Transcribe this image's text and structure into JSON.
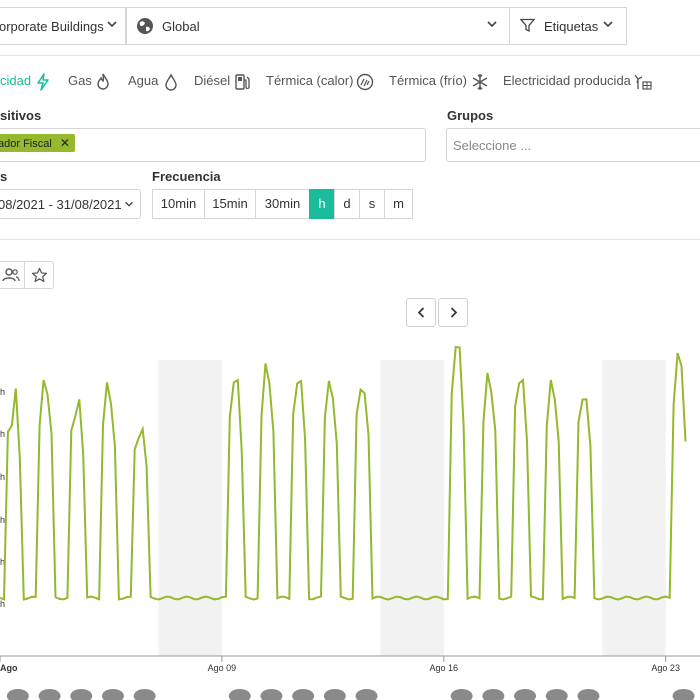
{
  "topbar": {
    "group_select": "orporate Buildings",
    "scope_select": "Global",
    "tags_select": "Etiquetas"
  },
  "energy_tabs": [
    {
      "label": "cidad",
      "icon": "lightning-icon",
      "active": true
    },
    {
      "label": "Gas",
      "icon": "flame-icon"
    },
    {
      "label": "Agua",
      "icon": "water-drop-icon"
    },
    {
      "label": "Diésel",
      "icon": "fuel-pump-icon"
    },
    {
      "label": "Térmica (calor)",
      "icon": "heat-icon"
    },
    {
      "label": "Térmica (frío)",
      "icon": "snowflake-icon"
    },
    {
      "label": "Electricidad producida",
      "icon": "wind-solar-icon"
    }
  ],
  "filters": {
    "devices_label": "sitivos",
    "device_chip": "ador Fiscal",
    "groups_label": "Grupos",
    "groups_placeholder": "Seleccione ...",
    "dates_label": "s",
    "date_range": "08/2021 - 31/08/2021",
    "frequency_label": "Frecuencia",
    "frequency_options": [
      "10min",
      "15min",
      "30min",
      "h",
      "d",
      "s",
      "m"
    ],
    "frequency_selected": "h"
  },
  "colors": {
    "accent": "#1abc9c",
    "series": "#95b82e",
    "weekend_band": "#f2f2f2"
  },
  "chart_data": {
    "type": "line",
    "y_tick_labels": [
      "h",
      "h",
      "h",
      "h",
      "h",
      "h"
    ],
    "x_tick_labels": [
      "Ago",
      "Ago 09",
      "Ago 16",
      "Ago 23"
    ],
    "grid": false,
    "series": [
      {
        "values": [
          0.15,
          0.15,
          1.1,
          1.2,
          1.35,
          1.0,
          0.15,
          0.15,
          0.15,
          0.15,
          1.2,
          1.4,
          1.38,
          1.1,
          0.15,
          0.15,
          0.15,
          0.15,
          1.1,
          1.25,
          1.3,
          1.0,
          0.15,
          0.15,
          0.15,
          0.15,
          1.2,
          1.4,
          1.3,
          1.05,
          0.15,
          0.15,
          0.15,
          0.15,
          1.0,
          1.1,
          1.15,
          0.9,
          0.15,
          0.15,
          0.15,
          0.15,
          0.15,
          0.15,
          0.15,
          0.15,
          0.15,
          0.15,
          0.15,
          0.15,
          0.15,
          0.15,
          0.15,
          0.15,
          0.15,
          0.15,
          0.15,
          0.15,
          1.2,
          1.45,
          1.4,
          1.05,
          0.15,
          0.15,
          0.15,
          0.15,
          1.25,
          1.5,
          1.45,
          1.1,
          0.15,
          0.15,
          0.15,
          0.15,
          1.2,
          1.45,
          1.4,
          1.1,
          0.15,
          0.15,
          0.15,
          0.15,
          1.25,
          1.4,
          1.35,
          1.05,
          0.15,
          0.15,
          0.15,
          0.15,
          1.2,
          1.4,
          1.35,
          1.1,
          0.15,
          0.15,
          0.15,
          0.15,
          0.15,
          0.15,
          0.15,
          0.15,
          0.15,
          0.15,
          0.15,
          0.15,
          0.15,
          0.15,
          0.15,
          0.15,
          0.15,
          0.15,
          0.15,
          0.15,
          1.35,
          1.65,
          1.6,
          1.2,
          0.15,
          0.15,
          0.15,
          0.15,
          1.2,
          1.45,
          1.4,
          1.1,
          0.15,
          0.15,
          0.15,
          0.15,
          1.25,
          1.45,
          1.4,
          1.1,
          0.15,
          0.15,
          0.15,
          0.15,
          1.2,
          1.4,
          1.35,
          1.05,
          0.15,
          0.15,
          0.15,
          0.15,
          1.15,
          1.35,
          1.3,
          1.05,
          0.15,
          0.15,
          0.15,
          0.15,
          0.15,
          0.15,
          0.15,
          0.15,
          0.15,
          0.15,
          0.15,
          0.15,
          0.15,
          0.15,
          0.15,
          0.15,
          0.15,
          0.15,
          0.15,
          0.15,
          1.3,
          1.6,
          1.5,
          1.1
        ]
      }
    ]
  }
}
